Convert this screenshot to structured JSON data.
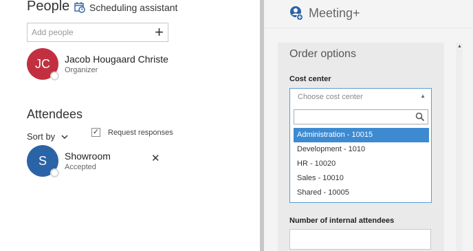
{
  "people": {
    "title": "People",
    "scheduling_label": "Scheduling assistant",
    "add_placeholder": "Add people",
    "add_icon": "+",
    "organizer": {
      "initials": "JC",
      "name": "Jacob Hougaard Christe",
      "role": "Organizer",
      "color": "#c23040"
    }
  },
  "attendees": {
    "title": "Attendees",
    "sort_label": "Sort by",
    "request_label": "Request responses",
    "request_checked": true,
    "items": [
      {
        "initials": "S",
        "name": "Showroom",
        "status": "Accepted",
        "color": "#2b64a6"
      }
    ],
    "remove_icon": "✕"
  },
  "addin": {
    "title": "Meeting+",
    "order_options_title": "Order options",
    "cost_center_label": "Cost center",
    "cost_center_placeholder": "Choose cost center",
    "cost_center_options": [
      "Administration - 10015",
      "Development - 1010",
      "HR - 10020",
      "Sales - 10010",
      "Shared - 10005"
    ],
    "selected_index": 0,
    "internal_attendees_label": "Number of internal attendees",
    "accent_color": "#3d8ad1"
  }
}
